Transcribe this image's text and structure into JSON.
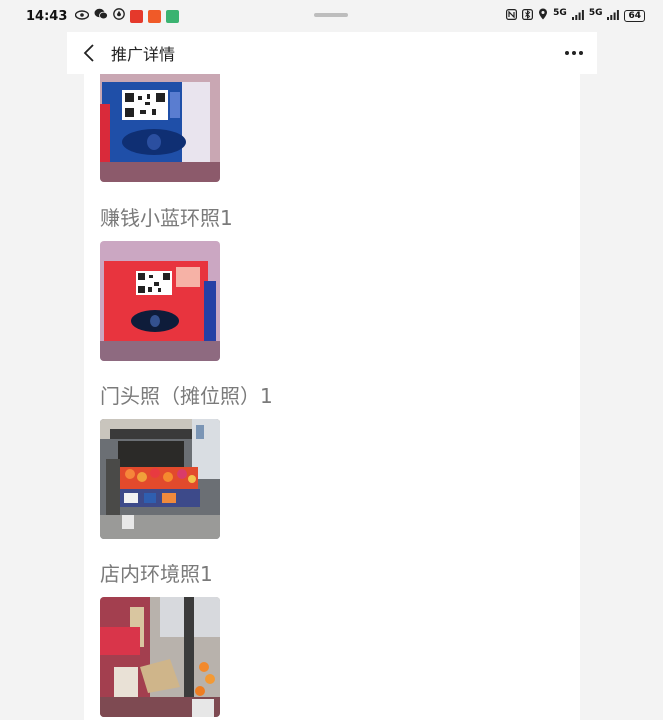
{
  "status_bar": {
    "time": "14:43",
    "network_1": "5G",
    "network_2": "5G",
    "battery": "64",
    "icons": [
      "eye-icon",
      "wechat-icon",
      "app-icon",
      "nfc-icon",
      "bluetooth-icon",
      "location-icon",
      "signal-icon"
    ]
  },
  "header": {
    "title": "推广详情",
    "back_icon": "chevron-left-icon",
    "more_icon": "more-horizontal-icon"
  },
  "sections": [
    {
      "label": "赚钱小蓝环照1"
    },
    {
      "label": "门头照（摊位照）1"
    },
    {
      "label": "店内环境照1"
    }
  ],
  "colors": {
    "background": "#f3f3f3",
    "panel": "#ffffff",
    "label": "#7a7a7a"
  }
}
